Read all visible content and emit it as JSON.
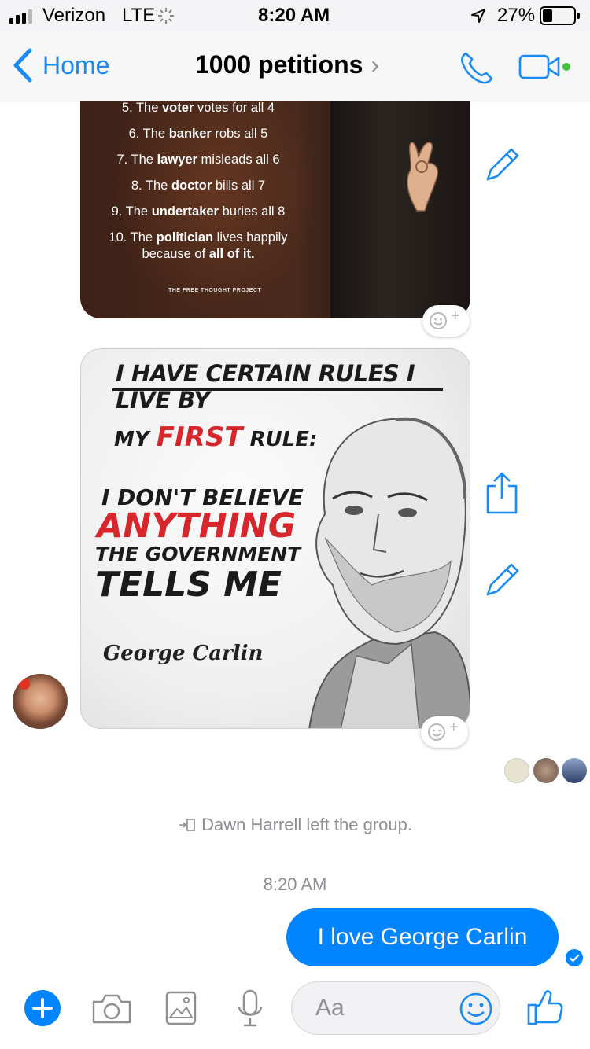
{
  "status": {
    "carrier": "Verizon",
    "network": "LTE",
    "time": "8:20 AM",
    "battery": "27%"
  },
  "nav": {
    "back_label": "Home",
    "title": "1000 petitions",
    "title_chevron": "›"
  },
  "image1": {
    "lines": [
      {
        "n": "5. The ",
        "b": "voter",
        "t": " votes for all 4"
      },
      {
        "n": "6. The ",
        "b": "banker",
        "t": " robs all 5"
      },
      {
        "n": "7. The ",
        "b": "lawyer",
        "t": " misleads all 6"
      },
      {
        "n": "8. The ",
        "b": "doctor",
        "t": " bills all 7"
      },
      {
        "n": "9. The ",
        "b": "undertaker",
        "t": " buries all 8"
      },
      {
        "n": "10. The ",
        "b": "politician",
        "t": " lives happily"
      },
      {
        "n": "because of ",
        "b": "all of it.",
        "t": ""
      }
    ],
    "watermark": "THE FREE THOUGHT PROJECT"
  },
  "image2": {
    "heading": "I HAVE CERTAIN RULES I LIVE BY",
    "rule_prefix": "MY ",
    "rule_word": "FIRST",
    "rule_suffix": " RULE:",
    "line1": "I DON'T BELIEVE",
    "line2": "ANYTHING",
    "line3": "THE GOVERNMENT",
    "line4": "TELLS ME",
    "signature": "George Carlin"
  },
  "reaction_plus": "+",
  "system_message": "Dawn Harrell left the group.",
  "timestamp": "8:20 AM",
  "my_message": "I love George Carlin",
  "composer": {
    "placeholder": "Aa"
  },
  "colors": {
    "accent": "#0084ff",
    "nav_blue": "#1a8af5",
    "red_text": "#d7262c"
  },
  "icons": [
    "phone-icon",
    "video-icon",
    "pencil-icon",
    "share-icon",
    "emoji-icon",
    "plus-icon",
    "camera-icon",
    "gallery-icon",
    "mic-icon",
    "like-icon"
  ]
}
